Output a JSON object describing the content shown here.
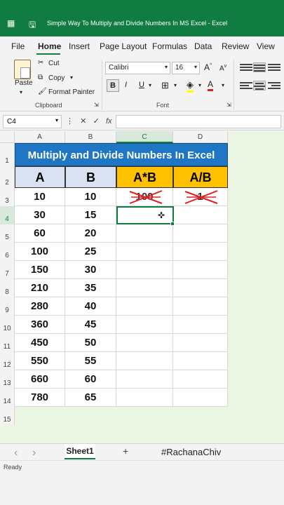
{
  "window": {
    "title": "Simple Way To Multiply and Divide Numbers In MS Excel  -  Excel"
  },
  "menu": [
    "File",
    "Home",
    "Insert",
    "Page Layout",
    "Formulas",
    "Data",
    "Review",
    "View"
  ],
  "ribbon": {
    "paste": "Paste",
    "cut": "Cut",
    "copy": "Copy",
    "format_painter": "Format Painter",
    "clipboard_group": "Clipboard",
    "font_name": "Calibri",
    "font_size": "16",
    "bold": "B",
    "italic": "I",
    "underline": "U",
    "font_group": "Font"
  },
  "formula_bar": {
    "name_box": "C4",
    "fx": "fx",
    "value": ""
  },
  "columns": [
    "A",
    "B",
    "C",
    "D"
  ],
  "row_numbers": [
    "1",
    "2",
    "3",
    "4",
    "5",
    "6",
    "7",
    "8",
    "9",
    "10",
    "11",
    "12",
    "13",
    "14",
    "15"
  ],
  "sheet": {
    "banner": "Multiply and Divide Numbers In Excel",
    "headers": [
      "A",
      "B",
      "A*B",
      "A/B"
    ],
    "rows": [
      [
        "10",
        "10",
        "100",
        "1"
      ],
      [
        "30",
        "15",
        "",
        ""
      ],
      [
        "60",
        "20",
        "",
        ""
      ],
      [
        "100",
        "25",
        "",
        ""
      ],
      [
        "150",
        "30",
        "",
        ""
      ],
      [
        "210",
        "35",
        "",
        ""
      ],
      [
        "280",
        "40",
        "",
        ""
      ],
      [
        "360",
        "45",
        "",
        ""
      ],
      [
        "450",
        "50",
        "",
        ""
      ],
      [
        "550",
        "55",
        "",
        ""
      ],
      [
        "660",
        "60",
        "",
        ""
      ],
      [
        "780",
        "65",
        "",
        ""
      ]
    ]
  },
  "tabs": {
    "sheet1": "Sheet1",
    "add": "+",
    "hashtag": "#RachanaChiv"
  },
  "status": {
    "ready": "Ready"
  },
  "colors": {
    "excel_green": "#107c41",
    "banner_blue": "#1f76c4",
    "header_blue": "#d9e1f2",
    "header_yellow": "#ffc000",
    "strike_red": "#e02020"
  }
}
